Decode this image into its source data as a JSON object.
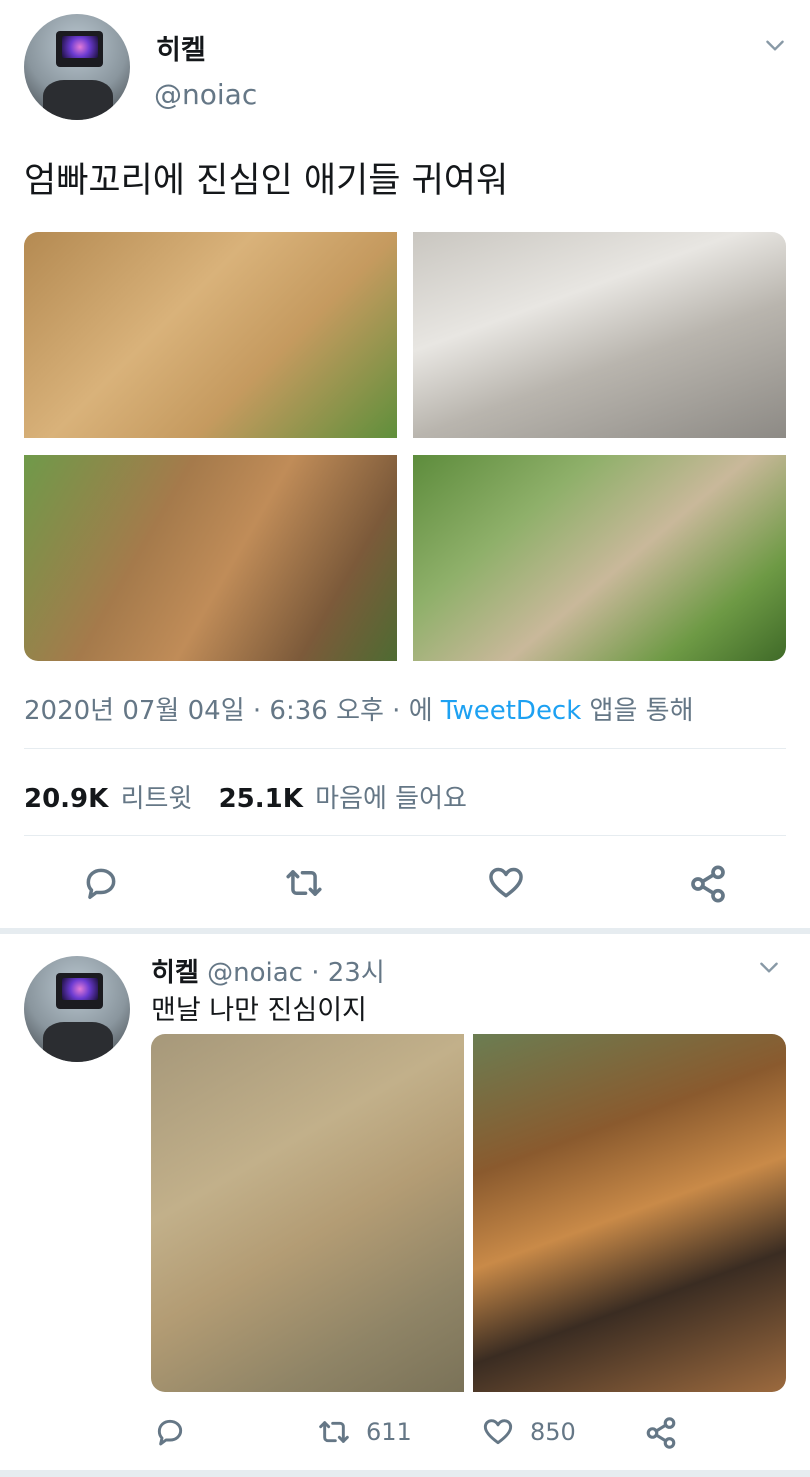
{
  "main_tweet": {
    "display_name": "히켈",
    "handle": "@noiac",
    "text": "엄빠꼬리에 진심인 애기들 귀여워",
    "timestamp_prefix": "2020년 07월 04일 · 6:36 오후 · 에 ",
    "client": "TweetDeck",
    "timestamp_suffix": " 앱을 통해",
    "retweet_count": "20.9K",
    "retweet_label": "리트윗",
    "like_count": "25.1K",
    "like_label": "마음에 들어요"
  },
  "reply_tweet": {
    "display_name": "히켈",
    "handle_time": "@noiac · 23시",
    "text": "맨날 나만 진심이지",
    "retweet_count": "611",
    "like_count": "850"
  },
  "colors": {
    "accent": "#1da1f2",
    "muted": "#657786",
    "divider": "#e6ecf0"
  },
  "icons": [
    "chevron-down-icon",
    "reply-icon",
    "retweet-icon",
    "heart-icon",
    "share-icon"
  ]
}
